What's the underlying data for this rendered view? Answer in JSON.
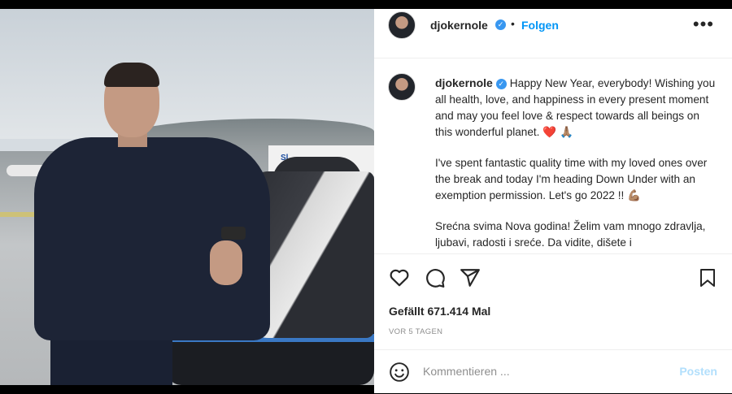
{
  "post": {
    "username": "djokernole",
    "follow_label": "Folgen",
    "more_icon": "more-horizontal-icon",
    "caption_paragraphs": [
      "Happy New Year, everybody! Wishing you all health, love, and happiness in every present moment and may you feel love & respect towards all beings on this wonderful planet. ❤️ 🙏🏽",
      "I've spent fantastic quality time with my loved ones over the break and today I'm heading Down Under with an exemption permission. Let's go 2022 !! 💪🏽",
      "Srećna svima Nova godina! Želim vam mnogo zdravlja, ljubavi, radosti i sreće. Da vidite, dišete i"
    ],
    "likes_text": "Gefällt 671.414 Mal",
    "time_text": "VOR 5 TAGEN",
    "comment_placeholder": "Kommentieren ...",
    "post_label": "Posten",
    "photo": {
      "sign_text": "Sl"
    }
  },
  "colors": {
    "accent": "#0095f6",
    "verified": "#3897f0",
    "post_disabled": "#b2dffc",
    "muted": "#8e8e8e"
  }
}
